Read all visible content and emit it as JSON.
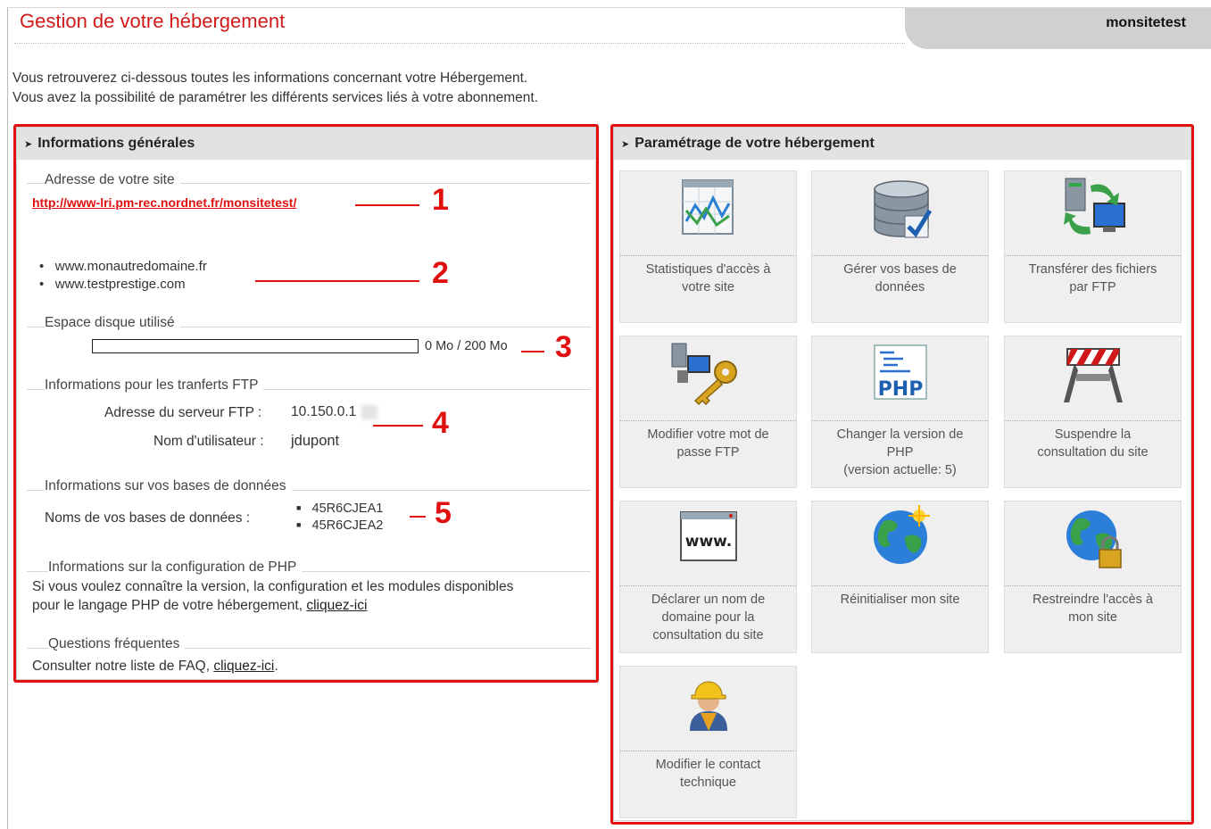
{
  "header": {
    "title": "Gestion de votre hébergement",
    "account_name": "monsitetest"
  },
  "intro": {
    "line1": "Vous retrouverez ci-dessous toutes les informations concernant votre Hébergement.",
    "line2": "Vous avez la possibilité de paramétrer les différents services liés à votre abonnement."
  },
  "info_panel": {
    "title": "Informations générales",
    "site_address": {
      "label": "Adresse de votre site",
      "url": "http://www-lri.pm-rec.nordnet.fr/monsitetest/"
    },
    "domains": [
      "www.monautredomaine.fr",
      "www.testprestige.com"
    ],
    "disk": {
      "label": "Espace disque utilisé",
      "usage_text": "0 Mo / 200 Mo",
      "used_fraction": 0
    },
    "ftp": {
      "label": "Informations pour les tranferts FTP",
      "server_label": "Adresse du serveur FTP :",
      "server_value": "10.150.0.1",
      "user_label": "Nom d'utilisateur :",
      "user_value": "jdupont"
    },
    "databases": {
      "label": "Informations sur vos bases de données",
      "names_label": "Noms de vos bases de données :",
      "names": [
        "45R6CJEA1",
        "45R6CJEA2"
      ]
    },
    "php": {
      "label": "Informations sur la configuration de PHP",
      "text1": "Si vous voulez connaître la version, la configuration et les modules disponibles",
      "text2": "pour le langage PHP de votre hébergement,",
      "link": "cliquez-ici"
    },
    "faq": {
      "label": "Questions fréquentes",
      "text": "Consulter notre liste de FAQ,",
      "link": "cliquez-ici",
      "end": "."
    }
  },
  "annotations": [
    "1",
    "2",
    "3",
    "4",
    "5"
  ],
  "settings_panel": {
    "title": "Paramétrage de votre hébergement",
    "tiles": [
      {
        "line1": "Statistiques d'accès à",
        "line2": "votre site",
        "line3": "",
        "icon": "chart-icon"
      },
      {
        "line1": "Gérer vos bases de",
        "line2": "données",
        "line3": "",
        "icon": "database-icon"
      },
      {
        "line1": "Transférer des fichiers",
        "line2": "par FTP",
        "line3": "",
        "icon": "ftp-transfer-icon"
      },
      {
        "line1": "Modifier votre mot de",
        "line2": "passe FTP",
        "line3": "",
        "icon": "key-icon"
      },
      {
        "line1": "Changer la version de",
        "line2": "PHP",
        "line3": "(version actuelle: 5)",
        "icon": "php-icon"
      },
      {
        "line1": "Suspendre la",
        "line2": "consultation du site",
        "line3": "",
        "icon": "barrier-icon"
      },
      {
        "line1": "Déclarer un nom de",
        "line2": "domaine pour la",
        "line3": "consultation du site",
        "icon": "www-icon"
      },
      {
        "line1": "Réinitialiser mon site",
        "line2": "",
        "line3": "",
        "icon": "globe-reset-icon"
      },
      {
        "line1": "Restreindre l'accès à",
        "line2": "mon site",
        "line3": "",
        "icon": "globe-lock-icon"
      },
      {
        "line1": "Modifier le contact",
        "line2": "technique",
        "line3": "",
        "icon": "worker-icon"
      }
    ]
  },
  "colors": {
    "accent": "#d01a1a",
    "panel_head": "#e2e2e2",
    "tile": "#efefef"
  }
}
